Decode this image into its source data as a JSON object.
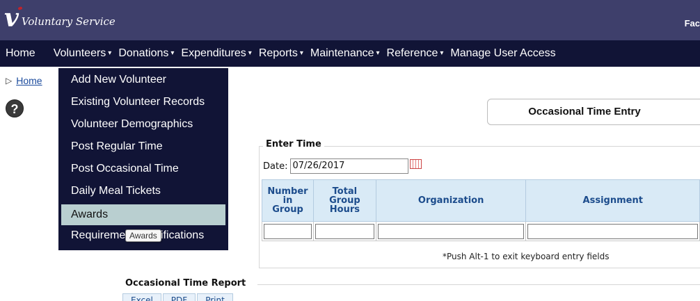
{
  "header": {
    "logo_mark": "v",
    "app_name": "Voluntary Service",
    "facility_partial": "Fac"
  },
  "nav": {
    "home": "Home",
    "volunteers": "Volunteers",
    "donations": "Donations",
    "expenditures": "Expenditures",
    "reports": "Reports",
    "maintenance": "Maintenance",
    "reference": "Reference",
    "manage_user_access": "Manage User Access",
    "caret": "▾"
  },
  "breadcrumb": {
    "marker": "▷",
    "home": "Home"
  },
  "help_icon": "?",
  "volunteers_menu": {
    "items": [
      "Add New Volunteer",
      "Existing Volunteer Records",
      "Volunteer Demographics",
      "Post Regular Time",
      "Post Occasional Time",
      "Daily Meal Tickets",
      "Awards",
      "Requirements Notifications"
    ],
    "active_index": 6,
    "tooltip": "Awards"
  },
  "page_title": "Occasional Time Entry",
  "enter_time": {
    "legend": "Enter Time",
    "date_label": "Date:",
    "date_value": "07/26/2017",
    "columns": {
      "number_in_group": [
        "Number",
        "in",
        "Group"
      ],
      "total_group_hours": [
        "Total",
        "Group",
        "Hours"
      ],
      "organization": "Organization",
      "assignment": "Assignment"
    },
    "note": "*Push Alt-1 to exit keyboard entry fields"
  },
  "report": {
    "legend": "Occasional Time Report",
    "buttons": [
      "Excel",
      "PDF",
      "Print"
    ]
  },
  "colors": {
    "header_bg": "#3e3f6b",
    "nav_bg": "#111436",
    "menu_active_bg": "#b9cfd0",
    "grid_header_bg": "#d9eaf6",
    "grid_header_text": "#1c4c8c"
  }
}
